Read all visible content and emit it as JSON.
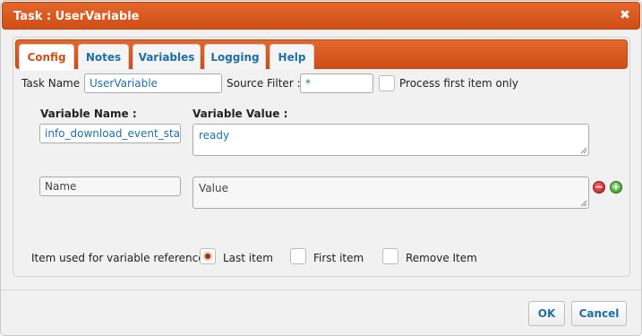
{
  "dialog": {
    "title": "Task : UserVariable",
    "close_glyph": "✖"
  },
  "tabs": [
    {
      "label": "Config",
      "active": true
    },
    {
      "label": "Notes",
      "active": false
    },
    {
      "label": "Variables",
      "active": false
    },
    {
      "label": "Logging",
      "active": false
    },
    {
      "label": "Help",
      "active": false
    }
  ],
  "config": {
    "task_name_label": "Task Name :",
    "task_name_value": "UserVariable",
    "source_filter_label": "Source Filter :",
    "source_filter_value": "*",
    "process_first_label": "Process first item only",
    "process_first_checked": false
  },
  "variables": {
    "name_header": "Variable Name :",
    "value_header": "Variable Value :",
    "rows": [
      {
        "name": "info_download_event_stat",
        "value": "ready"
      }
    ],
    "new_row": {
      "name_placeholder": "Name",
      "value_placeholder": "Value"
    }
  },
  "reference": {
    "label": "Item used for variable reference :",
    "options": [
      {
        "label": "Last item",
        "checked": true
      },
      {
        "label": "First item",
        "checked": false
      },
      {
        "label": "Remove Item",
        "checked": false
      }
    ]
  },
  "footer": {
    "ok_label": "OK",
    "cancel_label": "Cancel"
  },
  "colors": {
    "accent": "#cf4e16",
    "link": "#1d6fa5",
    "remove": "#b71c1c",
    "add": "#2f8f1f"
  },
  "icons": {
    "close": "close-icon",
    "remove": "minus-icon",
    "add": "plus-icon",
    "resize": "resize-grip-icon"
  }
}
